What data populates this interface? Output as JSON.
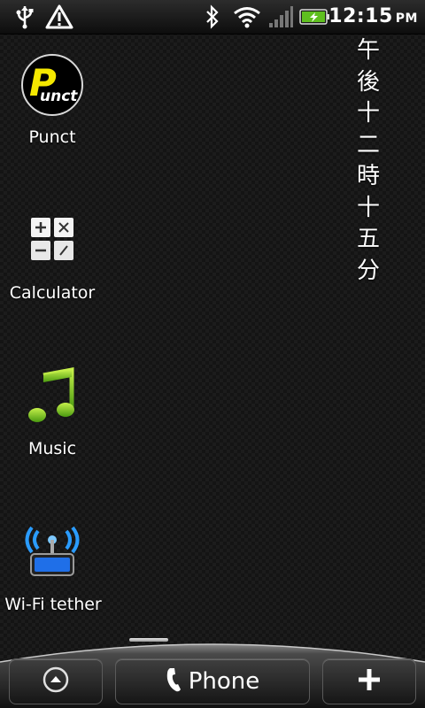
{
  "status_bar": {
    "icons": [
      "usb-icon",
      "warning-icon",
      "bluetooth-icon",
      "wifi-icon",
      "signal-icon",
      "battery-charging-icon"
    ],
    "time": "12:15",
    "ampm": "PM"
  },
  "apps": [
    {
      "name": "Punct",
      "icon": "punct-icon",
      "icon_text": "Punct",
      "icon_letter": "P"
    },
    {
      "name": "Calculator",
      "icon": "calculator-icon"
    },
    {
      "name": "Music",
      "icon": "music-note-icon"
    },
    {
      "name": "Wi-Fi tether",
      "icon": "wifi-tether-icon"
    }
  ],
  "vertical_clock": {
    "chars": [
      "午",
      "後",
      "十",
      "二",
      "時",
      "十",
      "五",
      "分"
    ]
  },
  "dock": {
    "left_icon": "up-arrow-icon",
    "phone_label": "Phone",
    "right_icon": "plus-icon"
  },
  "colors": {
    "accent_green": "#7fc41a",
    "wifi_blue": "#2a9cff",
    "punct_yellow": "#f5e800"
  }
}
